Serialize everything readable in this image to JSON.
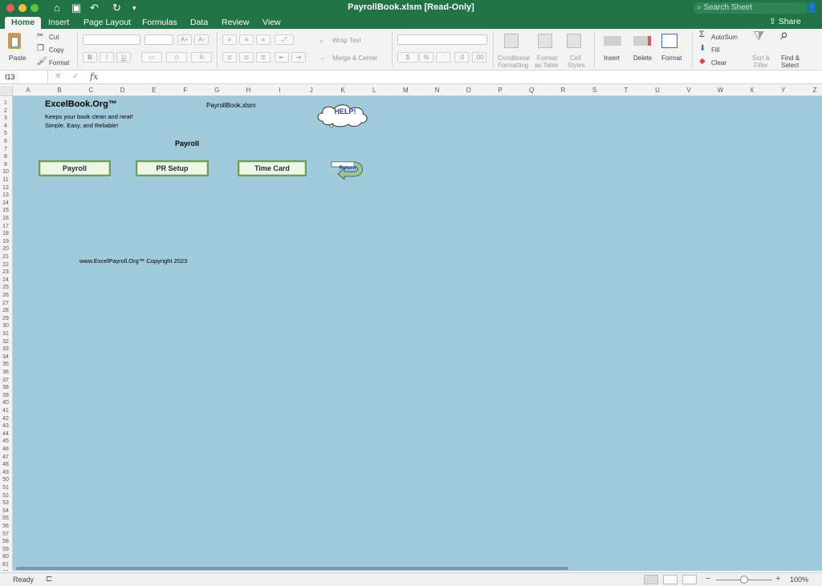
{
  "window": {
    "title": "PayrollBook.xlsm  [Read-Only]",
    "search_placeholder": "Search Sheet"
  },
  "tabs": [
    "Home",
    "Insert",
    "Page Layout",
    "Formulas",
    "Data",
    "Review",
    "View"
  ],
  "share_label": "Share",
  "ribbon": {
    "paste": "Paste",
    "cut": "Cut",
    "copy": "Copy",
    "format_painter": "Format",
    "wrap_text": "Wrap Text",
    "merge_center": "Merge & Center",
    "conditional_formatting_1": "Conditional",
    "conditional_formatting_2": "Formatting",
    "format_table_1": "Format",
    "format_table_2": "as Table",
    "cell_styles_1": "Cell",
    "cell_styles_2": "Styles",
    "insert": "Insert",
    "delete": "Delete",
    "format": "Format",
    "autosum": "AutoSum",
    "fill": "Fill",
    "clear": "Clear",
    "sort_filter_1": "Sort &",
    "sort_filter_2": "Filter",
    "find_select_1": "Find &",
    "find_select_2": "Select",
    "currency_symbol": "$",
    "percent_symbol": "%",
    "comma_symbol": "’",
    "bold": "B",
    "italic": "I",
    "underline": "U"
  },
  "formula_bar": {
    "name_box": "I13",
    "fx": "fx"
  },
  "columns": [
    "A",
    "B",
    "C",
    "D",
    "E",
    "F",
    "G",
    "H",
    "I",
    "J",
    "K",
    "L",
    "M",
    "N",
    "O",
    "P",
    "Q",
    "R",
    "S",
    "T",
    "U",
    "V",
    "W",
    "X",
    "Y",
    "Z"
  ],
  "rows_visible": 62,
  "sheet": {
    "brand": "ExcelBook.Org™",
    "tagline1": "Keeps your book clean and neat!",
    "tagline2": "Simple, Easy, and Reliable!",
    "filename": "PayrollBook.xlsm",
    "heading": "Payroll",
    "buttons": [
      "Payroll",
      "PR  Setup",
      "Time Card"
    ],
    "help": "HELP!",
    "return": "Return",
    "copyright": "www.ExcelPayroll.Org™ Copyright 2023"
  },
  "status": {
    "ready": "Ready",
    "zoom": "100%"
  },
  "colors": {
    "app_green": "#217346",
    "sheet_bg": "#a1cadb",
    "button_fill": "#eef7e4",
    "button_border": "#6f9b56"
  }
}
